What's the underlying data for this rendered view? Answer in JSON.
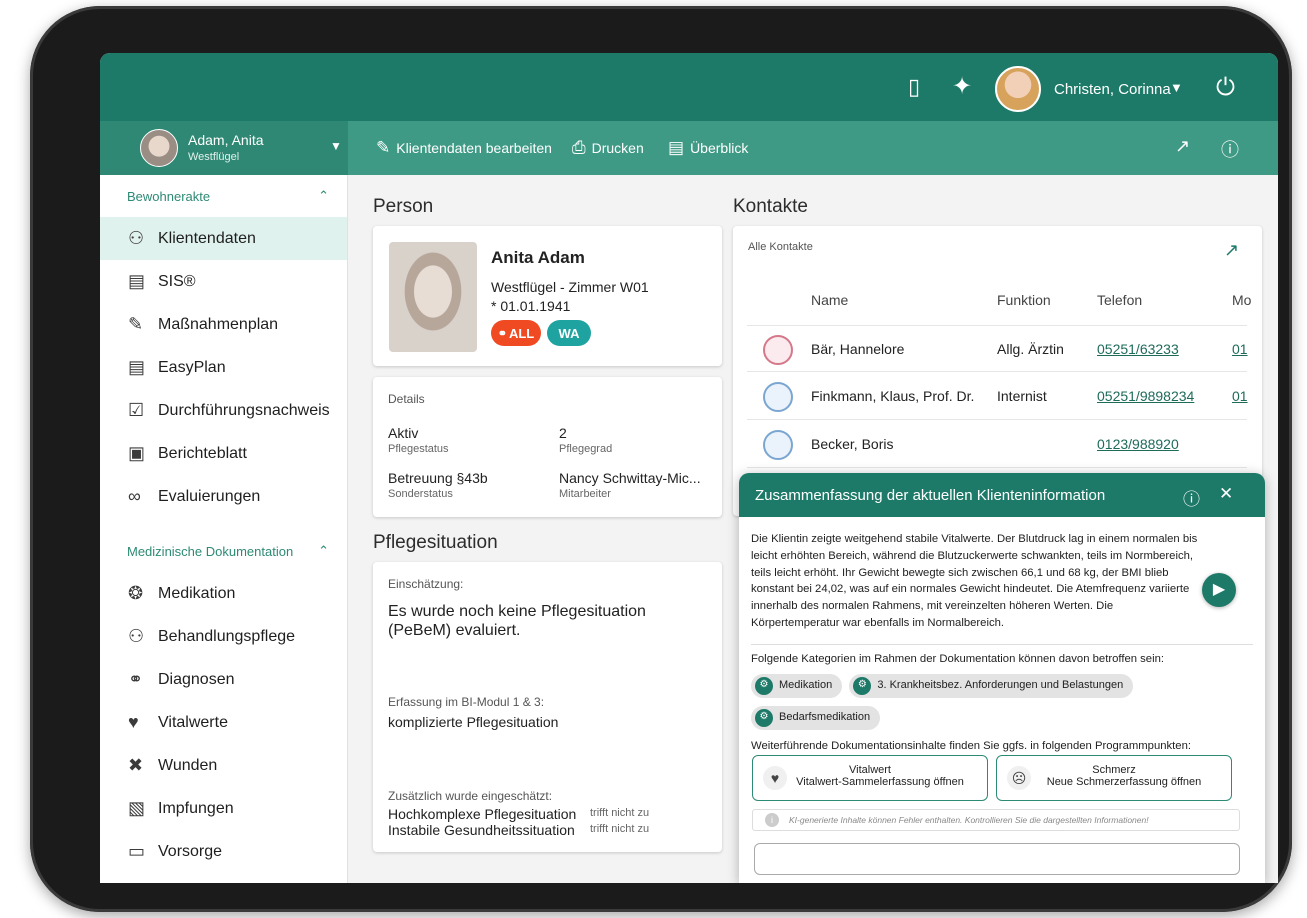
{
  "topbar": {
    "user_name": "Christen, Corinna"
  },
  "subbar": {
    "client_name": "Adam, Anita",
    "client_ward": "Westflügel",
    "actions": [
      "Klientendaten bearbeiten",
      "Drucken",
      "Überblick"
    ]
  },
  "sidebar": {
    "section1": "Bewohnerakte",
    "items1": [
      "Klientendaten",
      "SIS®",
      "Maßnahmenplan",
      "EasyPlan",
      "Durchführungsnachweis",
      "Berichteblatt",
      "Evaluierungen"
    ],
    "section2": "Medizinische Dokumentation",
    "items2": [
      "Medikation",
      "Behandlungspflege",
      "Diagnosen",
      "Vitalwerte",
      "Wunden",
      "Impfungen",
      "Vorsorge"
    ]
  },
  "person": {
    "title": "Person",
    "name": "Anita Adam",
    "room": "Westflügel - Zimmer W01",
    "dob": "* 01.01.1941",
    "badge_all": "ALL",
    "badge_wa": "WA"
  },
  "details": {
    "title": "Details",
    "status_val": "Aktiv",
    "status_lbl": "Pflegestatus",
    "grade_val": "2",
    "grade_lbl": "Pflegegrad",
    "special_val": "Betreuung §43b",
    "special_lbl": "Sonderstatus",
    "staff_val": "Nancy Schwittay-Mic...",
    "staff_lbl": "Mitarbeiter"
  },
  "pflege": {
    "title": "Pflegesituation",
    "assessment_lbl": "Einschätzung:",
    "assessment_text": "Es wurde noch keine Pflegesituation (PeBeM) evaluiert.",
    "bi_lbl": "Erfassung im BI-Modul 1 & 3:",
    "bi_text": "komplizierte Pflegesituation",
    "extra_lbl": "Zusätzlich wurde eingeschätzt:",
    "extra1": "Hochkomplexe Pflegesituation",
    "extra1_state": "trifft nicht zu",
    "extra2": "Instabile Gesundheitssituation",
    "extra2_state": "trifft nicht zu"
  },
  "contacts": {
    "title": "Kontakte",
    "subtitle": "Alle Kontakte",
    "headers": [
      "Name",
      "Funktion",
      "Telefon",
      "Mo"
    ],
    "rows": [
      {
        "name": "Bär, Hannelore",
        "function": "Allg. Ärztin",
        "phone": "05251/63233",
        "more": "01"
      },
      {
        "name": "Finkmann, Klaus, Prof. Dr.",
        "function": "Internist",
        "phone": "05251/9898234",
        "more": "01"
      },
      {
        "name": "Becker, Boris",
        "function": "",
        "phone": "0123/988920",
        "more": ""
      }
    ]
  },
  "popup": {
    "title": "Zusammenfassung der aktuellen Klienteninformation",
    "summary": "Die Klientin zeigte weitgehend stabile Vitalwerte. Der Blutdruck lag in einem normalen bis leicht erhöhten Bereich, während die Blutzuckerwerte schwankten, teils im Normbereich, teils leicht erhöht. Ihr Gewicht bewegte sich zwischen 66,1 und 68 kg, der BMI blieb konstant bei 24,02, was auf ein normales Gewicht hindeutet. Die Atemfrequenz variierte innerhalb des normalen Rahmens, mit vereinzelten höheren Werten. Die Körpertemperatur war ebenfalls im Normalbereich.",
    "categories_lbl": "Folgende Kategorien im Rahmen der Dokumentation können davon betroffen sein:",
    "chips": [
      "Medikation",
      "3. Krankheitsbez. Anforderungen und Belastungen",
      "Bedarfsmedikation"
    ],
    "further_lbl": "Weiterführende Dokumentationsinhalte finden Sie ggfs. in folgenden Programmpunkten:",
    "btn1_title": "Vitalwert",
    "btn1_sub": "Vitalwert-Sammelerfassung öffnen",
    "btn2_title": "Schmerz",
    "btn2_sub": "Neue Schmerzerfassung öffnen",
    "disclaimer": "KI-generierte Inhalte können Fehler enthalten. Kontrollieren Sie die dargestellten Informationen!"
  }
}
